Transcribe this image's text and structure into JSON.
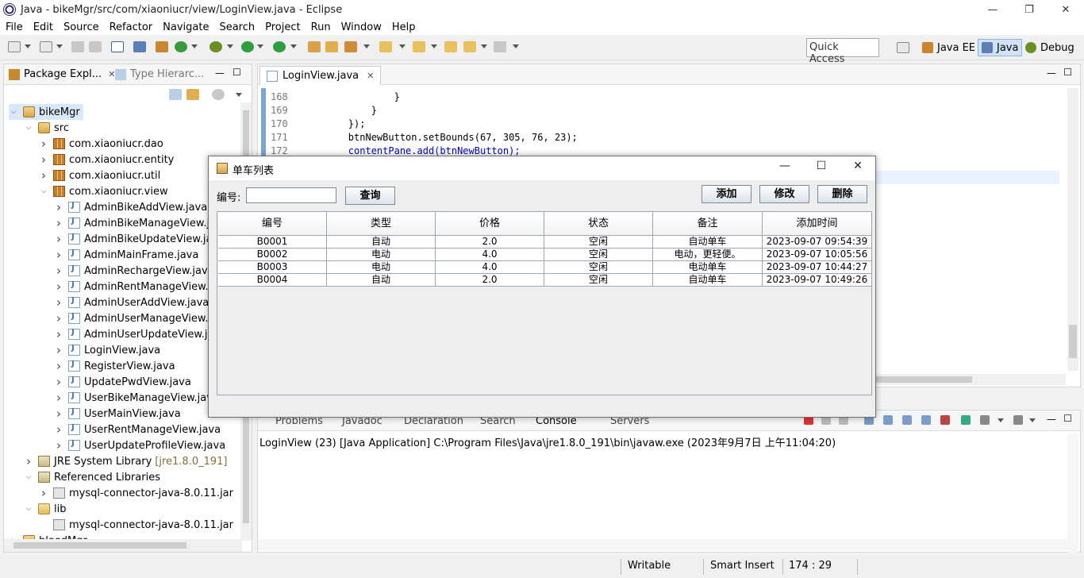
{
  "window": {
    "title": "Java - bikeMgr/src/com/xiaoniucr/view/LoginView.java - Eclipse",
    "min": "—",
    "max": "❐",
    "close": "✕"
  },
  "menu": [
    "File",
    "Edit",
    "Source",
    "Refactor",
    "Navigate",
    "Search",
    "Project",
    "Run",
    "Window",
    "Help"
  ],
  "toolbar": {
    "quick_access": "Quick Access"
  },
  "perspectives": [
    "Java EE",
    "Java",
    "Debug"
  ],
  "package_explorer": {
    "tabs": [
      "Package Expl...",
      "Type Hierarc..."
    ],
    "tree": [
      {
        "label": "bikeMgr",
        "icon": "project-icon",
        "level": 0,
        "expanded": true,
        "selected": true
      },
      {
        "label": "src",
        "icon": "source-folder-icon",
        "level": 1,
        "expanded": true
      },
      {
        "label": "com.xiaoniucr.dao",
        "icon": "package-icon",
        "level": 2,
        "expanded": false
      },
      {
        "label": "com.xiaoniucr.entity",
        "icon": "package-icon",
        "level": 2,
        "expanded": false
      },
      {
        "label": "com.xiaoniucr.util",
        "icon": "package-icon",
        "level": 2,
        "expanded": false
      },
      {
        "label": "com.xiaoniucr.view",
        "icon": "package-icon",
        "level": 2,
        "expanded": true
      },
      {
        "label": "AdminBikeAddView.java",
        "icon": "java-file-icon",
        "level": 3,
        "expanded": false
      },
      {
        "label": "AdminBikeManageView.java",
        "icon": "java-file-icon",
        "level": 3,
        "expanded": false
      },
      {
        "label": "AdminBikeUpdateView.java",
        "icon": "java-file-icon",
        "level": 3,
        "expanded": false
      },
      {
        "label": "AdminMainFrame.java",
        "icon": "java-file-icon",
        "level": 3,
        "expanded": false
      },
      {
        "label": "AdminRechargeView.java",
        "icon": "java-file-icon",
        "level": 3,
        "expanded": false
      },
      {
        "label": "AdminRentManageView.java",
        "icon": "java-file-icon",
        "level": 3,
        "expanded": false
      },
      {
        "label": "AdminUserAddView.java",
        "icon": "java-file-icon",
        "level": 3,
        "expanded": false
      },
      {
        "label": "AdminUserManageView.java",
        "icon": "java-file-icon",
        "level": 3,
        "expanded": false
      },
      {
        "label": "AdminUserUpdateView.java",
        "icon": "java-file-icon",
        "level": 3,
        "expanded": false
      },
      {
        "label": "LoginView.java",
        "icon": "java-file-icon",
        "level": 3,
        "expanded": false
      },
      {
        "label": "RegisterView.java",
        "icon": "java-file-icon",
        "level": 3,
        "expanded": false
      },
      {
        "label": "UpdatePwdView.java",
        "icon": "java-file-icon",
        "level": 3,
        "expanded": false
      },
      {
        "label": "UserBikeManageView.java",
        "icon": "java-file-icon",
        "level": 3,
        "expanded": false
      },
      {
        "label": "UserMainView.java",
        "icon": "java-file-icon",
        "level": 3,
        "expanded": false
      },
      {
        "label": "UserRentManageView.java",
        "icon": "java-file-icon",
        "level": 3,
        "expanded": false
      },
      {
        "label": "UserUpdateProfileView.java",
        "icon": "java-file-icon",
        "level": 3,
        "expanded": false
      },
      {
        "label": "JRE System Library",
        "extra": "[jre1.8.0_191]",
        "icon": "library-icon",
        "level": 1,
        "expanded": false
      },
      {
        "label": "Referenced Libraries",
        "icon": "library-icon",
        "level": 1,
        "expanded": true
      },
      {
        "label": "mysql-connector-java-8.0.11.jar",
        "icon": "jar-icon",
        "level": 2,
        "expanded": false
      },
      {
        "label": "lib",
        "icon": "folder-icon",
        "level": 1,
        "expanded": true
      },
      {
        "label": "mysql-connector-java-8.0.11.jar",
        "icon": "jar-icon",
        "level": 2,
        "leaf": true
      },
      {
        "label": "bloodMgr",
        "icon": "project-icon",
        "level": 0,
        "expanded": false
      }
    ]
  },
  "editor": {
    "tab": "LoginView.java",
    "lines": [
      {
        "no": "168",
        "code": "                }"
      },
      {
        "no": "169",
        "code": "            }"
      },
      {
        "no": "170",
        "code": "        });"
      },
      {
        "no": "171",
        "code": "        btnNewButton.setBounds(67, 305, 76, 23);"
      },
      {
        "no": "172",
        "code": "        contentPane.add(btnNewButton);"
      }
    ]
  },
  "console": {
    "tabs": [
      "Problems",
      "Javadoc",
      "Declaration",
      "Search",
      "Console",
      "Servers"
    ],
    "text": "LoginView (23) [Java Application] C:\\Program Files\\Java\\jre1.8.0_191\\bin\\javaw.exe (2023年9月7日 上午11:04:20)"
  },
  "status": {
    "writable": "Writable",
    "insert_mode": "Smart Insert",
    "position": "174 : 29"
  },
  "dialog": {
    "title": "单车列表",
    "search_label": "编号:",
    "search_value": "",
    "query_button": "查询",
    "add_button": "添加",
    "edit_button": "修改",
    "delete_button": "删除",
    "columns": [
      "编号",
      "类型",
      "价格",
      "状态",
      "备注",
      "添加时间"
    ],
    "rows": [
      [
        "B0001",
        "自动",
        "2.0",
        "空闲",
        "自动单车",
        "2023-09-07 09:54:39"
      ],
      [
        "B0002",
        "电动",
        "4.0",
        "空闲",
        "电动，更轻便。",
        "2023-09-07 10:05:56"
      ],
      [
        "B0003",
        "电动",
        "4.0",
        "空闲",
        "电动单车",
        "2023-09-07 10:44:27"
      ],
      [
        "B0004",
        "自动",
        "2.0",
        "空闲",
        "自动单车",
        "2023-09-07 10:49:26"
      ]
    ]
  }
}
